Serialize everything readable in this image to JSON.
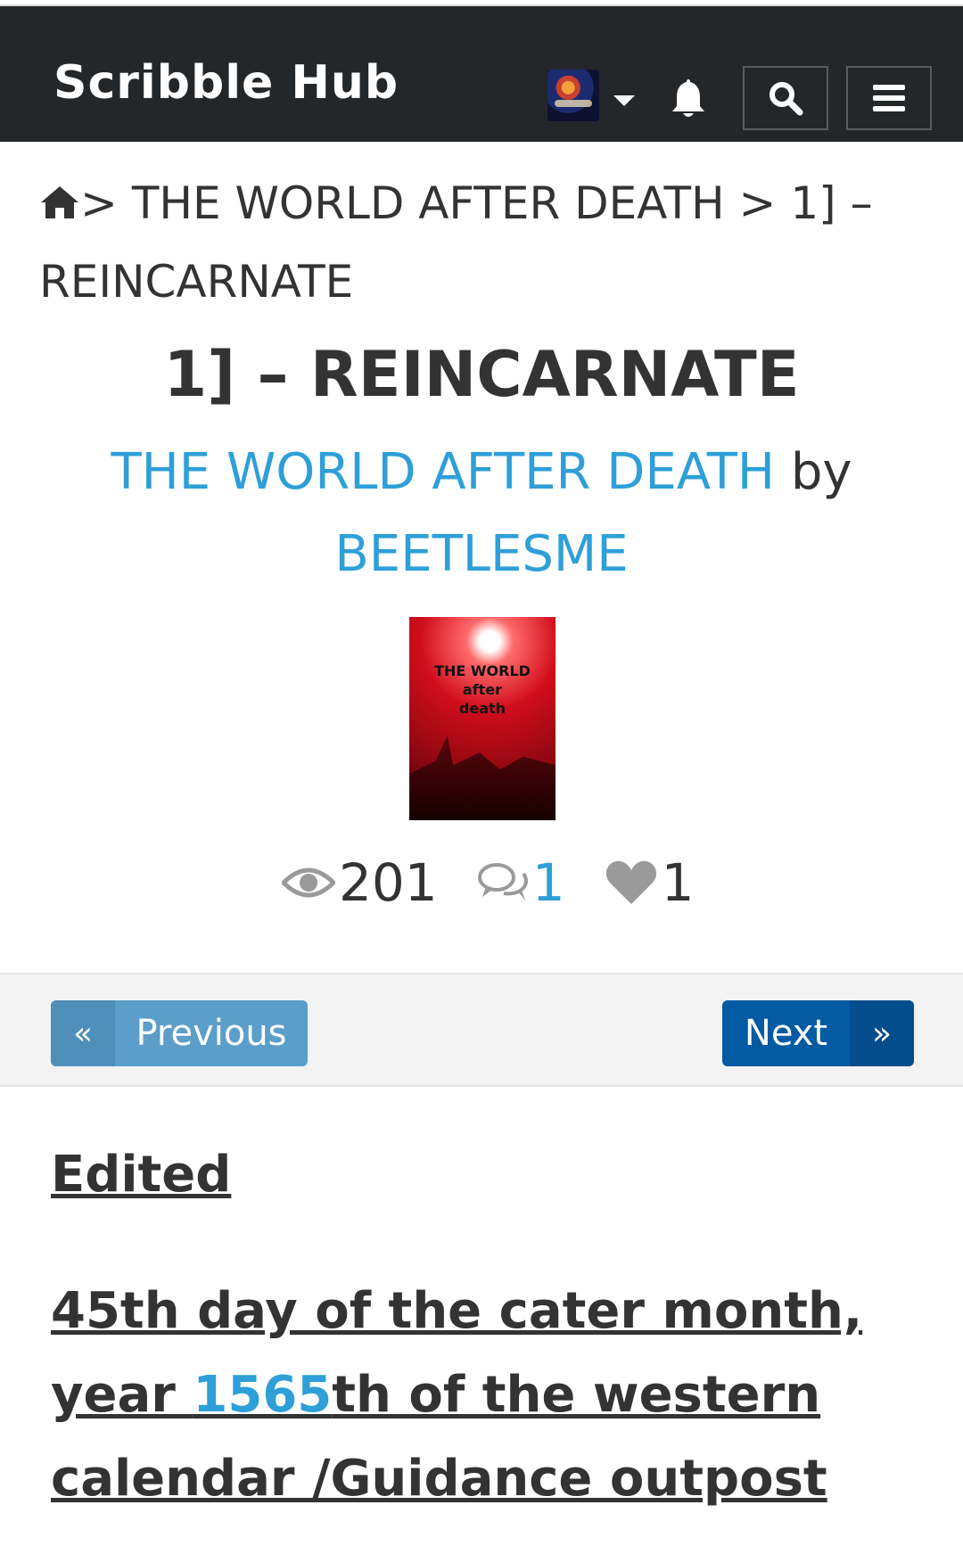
{
  "header": {
    "brand": "Scribble Hub",
    "icons": [
      "user-avatar",
      "caret-down-icon",
      "bell-icon",
      "search-icon",
      "menu-icon"
    ],
    "background": "#23272a"
  },
  "breadcrumb": {
    "separator": ">",
    "series": "THE WORLD AFTER DEATH",
    "chapter": "1] – REINCARNATE"
  },
  "chapter": {
    "title": "1] – REINCARNATE",
    "series_link": "THE WORLD AFTER DEATH",
    "by": "by",
    "author": "BEETLESME",
    "cover_lines": [
      "THE WORLD",
      "after",
      "death"
    ]
  },
  "stats": {
    "views": "201",
    "comments": "1",
    "likes": "1"
  },
  "navigation": {
    "prev_arrow": "«",
    "prev_label": "Previous",
    "next_label": "Next",
    "next_arrow": "»",
    "prev_color": "#5b9ec9",
    "next_color": "#045aa3"
  },
  "content": {
    "edited": "Edited ",
    "para_part1": "45th day of the cater month, year ",
    "para_number": "1565",
    "para_part2": "th of the western calendar /Guidance outpost"
  },
  "colors": {
    "link": "#2e9fd8",
    "text": "#333333"
  }
}
